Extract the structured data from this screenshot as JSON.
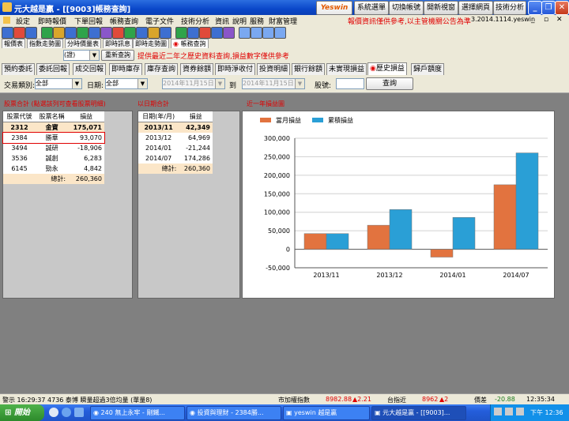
{
  "window": {
    "title": "元大越是贏 - [[9003]帳務查詢]",
    "buttons": [
      "系統選單",
      "切換帳號",
      "開新視窗",
      "選擇網頁",
      "技術分析"
    ],
    "brand": "Yeswin"
  },
  "menu": [
    "設定",
    "即時報價",
    "下單回報",
    "帳務查詢",
    "電子文件",
    "技術分析",
    "資訊",
    "說明",
    "服務",
    "財富管理"
  ],
  "menu_notice": "報價資訊僅供參考,以主管機關公告為準",
  "version": "3.2014.1114.yeswin",
  "subtabs": [
    "報價表",
    "指數走勢圖",
    "分時價量表",
    "即時訊息",
    "即時走勢圖",
    "帳務查詢"
  ],
  "account": {
    "value": "(證)",
    "refresh": "重新查詢",
    "notice": "提供最近二年之歷史資料查詢,損益數字僅供參考"
  },
  "tabs": [
    "預約委託",
    "委託回報",
    "成交回報",
    "即時庫存",
    "庫存查詢",
    "資券餘額",
    "即時淨收付",
    "投資明細",
    "銀行餘額",
    "未實現損益",
    "歷史損益",
    "歸戶額度"
  ],
  "filter": {
    "type_label": "交易類別:",
    "type_value": "全部",
    "date_label": "日期:",
    "date_value": "全部",
    "date_from": "2014年11月15日",
    "to": "到",
    "date_to": "2014年11月15日",
    "stock_label": "股號:",
    "query": "查詢"
  },
  "stock_panel": {
    "caption": "股票合計 (點選該列可查看股票明細)",
    "headers": [
      "股票代號",
      "股票名稱",
      "損益"
    ],
    "total": {
      "code": "2312",
      "name": "金寶",
      "pl": "175,071"
    },
    "rows": [
      {
        "code": "2384",
        "name": "勝華",
        "pl": "93,070"
      },
      {
        "code": "3494",
        "name": "誠研",
        "pl": "-18,906"
      },
      {
        "code": "3536",
        "name": "誠創",
        "pl": "6,283"
      },
      {
        "code": "6145",
        "name": "勁永",
        "pl": "4,842"
      }
    ],
    "sum_label": "總計:",
    "sum_value": "260,360"
  },
  "date_panel": {
    "caption": "以日期合計",
    "headers": [
      "日期(年/月)",
      "損益"
    ],
    "total": {
      "date": "2013/11",
      "pl": "42,349"
    },
    "rows": [
      {
        "date": "2013/12",
        "pl": "64,969"
      },
      {
        "date": "2014/01",
        "pl": "-21,244"
      },
      {
        "date": "2014/07",
        "pl": "174,286"
      }
    ],
    "sum_label": "總計:",
    "sum_value": "260,360"
  },
  "chart_caption": "近一年損益圖",
  "chart_data": {
    "type": "bar",
    "categories": [
      "2013/11",
      "2013/12",
      "2014/01",
      "2014/07"
    ],
    "series": [
      {
        "name": "當月損益",
        "values": [
          42349,
          64969,
          -21244,
          174286
        ],
        "color": "#e2733f"
      },
      {
        "name": "累積損益",
        "values": [
          42349,
          107318,
          86074,
          260360
        ],
        "color": "#2a9fd6"
      }
    ],
    "ylim": [
      -50000,
      300000
    ],
    "yticks": [
      "300,000",
      "250,000",
      "200,000",
      "150,000",
      "100,000",
      "50,000",
      "0",
      "-50,000"
    ],
    "grid": true,
    "legend": "top-left"
  },
  "status": {
    "message": "警示 16:29:37 4736 泰博 瞬量超過3倍均量 (單量8)",
    "idx1_label": "市加權指數",
    "idx1_value": "8982.88",
    "idx1_change": "▲2.21",
    "idx2_label": "台指近",
    "idx2_value": "8962",
    "idx2_change": "▲2",
    "spread_label": "價差",
    "spread_value": "-20.88",
    "time": "12:35:34"
  },
  "taskbar": {
    "start": "開始",
    "tasks": [
      "240 無上永牢 - 剛鐵...",
      "投資與理財 - 2384勝...",
      "yeswin 越是贏",
      "元大越是贏 - [[9003]..."
    ],
    "clock": "下午 12:36"
  }
}
